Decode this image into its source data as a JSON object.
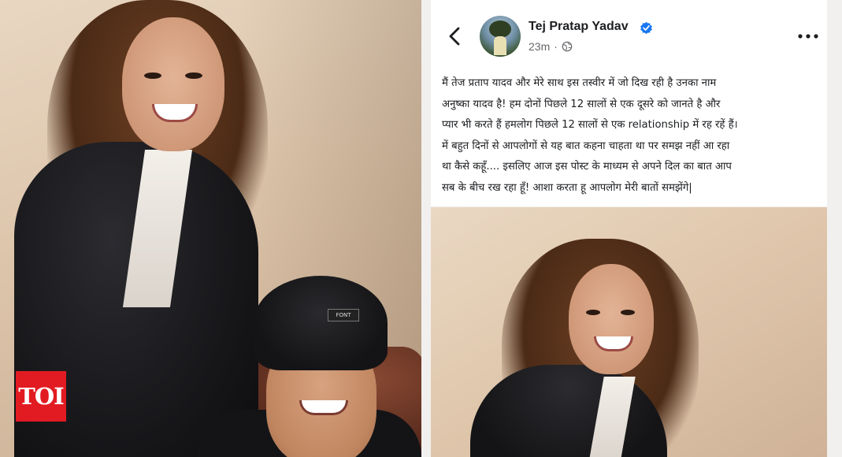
{
  "post": {
    "author": "Tej Pratap Yadav",
    "timestamp": "23m",
    "text_lines": [
      "मैं तेज प्रताप यादव और  मेरे साथ इस तस्वीर में जो दिख रही है उनका नाम",
      "अनुष्का यादव है! हम दोनों पिछले 12 सालों से एक दूसरे को जानते है और",
      "प्यार भी करते हैं हमलोग पिछले 12 सालों से एक relationship में रह रहें हैं।",
      "में बहुत दिनों से आपलोगों से यह बात कहना चाहता था पर समझ नहीं आ रहा",
      "था कैसे कहूँ.... इसलिए आज इस पोस्ट के माध्यम से अपने दिल का बात आप",
      "सब के बीच रख रहा हूँ! आशा करता हू आपलोग मेरी बातों समझेंगे|"
    ]
  },
  "hat_tag": "FONT",
  "logo": {
    "text": "TOI"
  },
  "icons": [
    "chevron-left-icon",
    "verified-badge-icon",
    "globe-icon",
    "more-options-icon"
  ],
  "colors": {
    "toi_red": "#e21b22",
    "fb_blue": "#1877f2"
  }
}
